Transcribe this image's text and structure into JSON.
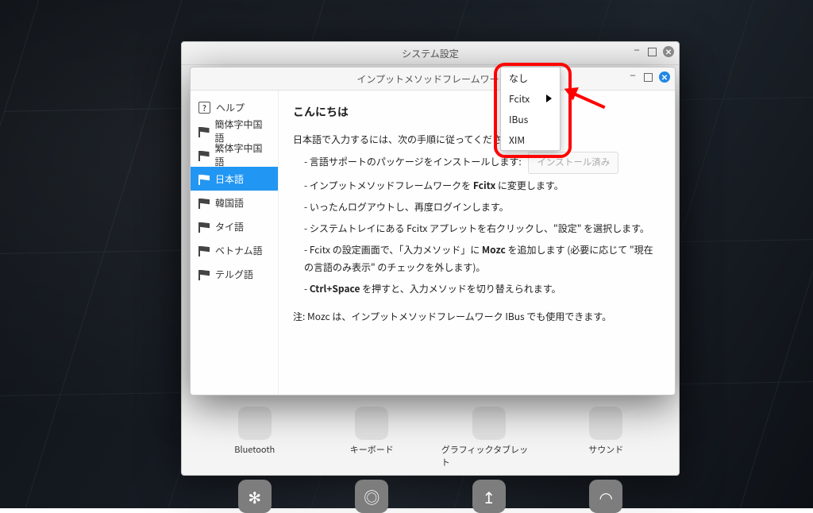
{
  "settings_window": {
    "title": "システム設定",
    "tiles_row1": [
      {
        "label": "Bluetooth",
        "icon": "bt"
      },
      {
        "label": "キーボード",
        "icon": "kb"
      },
      {
        "label": "グラフィックタブレット",
        "icon": "tablet"
      },
      {
        "label": "サウンド",
        "icon": "sound"
      }
    ]
  },
  "im_window": {
    "title": "インプットメソッドフレームワーク",
    "sidebar": [
      {
        "label": "ヘルプ",
        "kind": "help"
      },
      {
        "label": "簡体字中国語",
        "kind": "flag"
      },
      {
        "label": "繁体字中国語",
        "kind": "flag"
      },
      {
        "label": "日本語",
        "kind": "flag",
        "selected": true
      },
      {
        "label": "韓国語",
        "kind": "flag"
      },
      {
        "label": "タイ語",
        "kind": "flag"
      },
      {
        "label": "ベトナム語",
        "kind": "flag"
      },
      {
        "label": "テルグ語",
        "kind": "flag"
      }
    ],
    "content": {
      "heading": "こんにちは",
      "intro": "日本語で入力するには、次の手順に従ってください:",
      "step1_pre": "- 言語サポートのパッケージをインストールします:",
      "install_btn": "インストール済み",
      "step2_pre": "- インプットメソッドフレームワークを ",
      "step2_bold": "Fcitx",
      "step2_post": " に変更します。",
      "step3": "- いったんログアウトし、再度ログインします。",
      "step4": "- システムトレイにある Fcitx アプレットを右クリックし、\"設定\" を選択します。",
      "step5_pre": "- Fcitx の設定画面で、「入力メソッド」に ",
      "step5_bold": "Mozc",
      "step5_post": " を追加します (必要に応じて \"現在の言語のみ表示\" のチェックを外します)。",
      "step6_pre": "- ",
      "step6_bold": "Ctrl+Space",
      "step6_post": " を押すと、入力メソッドを切り替えられます。",
      "note": "注: Mozc は、インプットメソッドフレームワーク IBus でも使用できます。"
    }
  },
  "dropdown": {
    "items": [
      {
        "label": "なし",
        "submenu": false
      },
      {
        "label": "Fcitx",
        "submenu": true
      },
      {
        "label": "IBus",
        "submenu": false
      },
      {
        "label": "XIM",
        "submenu": false
      }
    ]
  }
}
